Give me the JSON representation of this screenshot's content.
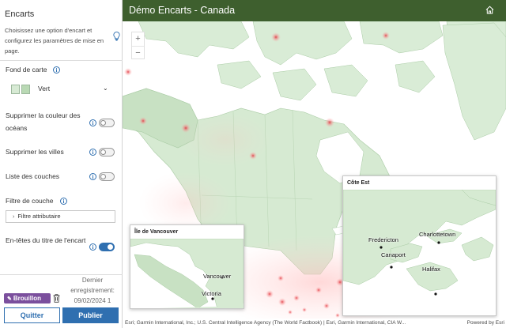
{
  "panel": {
    "title": "Encarts",
    "description": "Choisissez une option d'encart et configurez les paramètres de mise en page.",
    "basemap": {
      "label": "Fond de carte",
      "value": "Vert",
      "swatch_colors": [
        "#d7ead4",
        "#b9d9b4"
      ]
    },
    "options": [
      {
        "label": "Supprimer la couleur des océans",
        "state": false
      },
      {
        "label": "Supprimer les villes",
        "state": false
      },
      {
        "label": "Liste des couches",
        "state": false
      }
    ],
    "layer_filter": {
      "label": "Filtre de couche",
      "button": "Filtre attributaire"
    },
    "title_headers": {
      "label": "En-têtes du titre de l'encart",
      "state": true
    },
    "status_badge": "Brouillon",
    "last_saved": "Dernier enregistrement: 09/02/2024 1",
    "quit": "Quitter",
    "publish": "Publier"
  },
  "header": {
    "title": "Démo Encarts - Canada"
  },
  "map": {
    "zoom_in": "+",
    "zoom_out": "−",
    "attribution": "Esri; Garmin International, Inc.; U.S. Central Intelligence Agency (The World Factbook) | Esri, Garmin International, CIA W...",
    "powered_by": "Powered by Esri",
    "inset_vancouver": {
      "title": "Île de Vancouver",
      "cities": [
        "Vancouver",
        "Victoria"
      ]
    },
    "inset_east": {
      "title": "Côte Est",
      "cities": [
        "Fredericton",
        "Charlottetown",
        "Canaport",
        "Halifax"
      ]
    }
  },
  "colors": {
    "header": "#3e5f2e",
    "accent": "#2f6fb0",
    "land": "#cfe5cc",
    "hotspot": "#e0303a",
    "badge": "#7b4f9d"
  }
}
